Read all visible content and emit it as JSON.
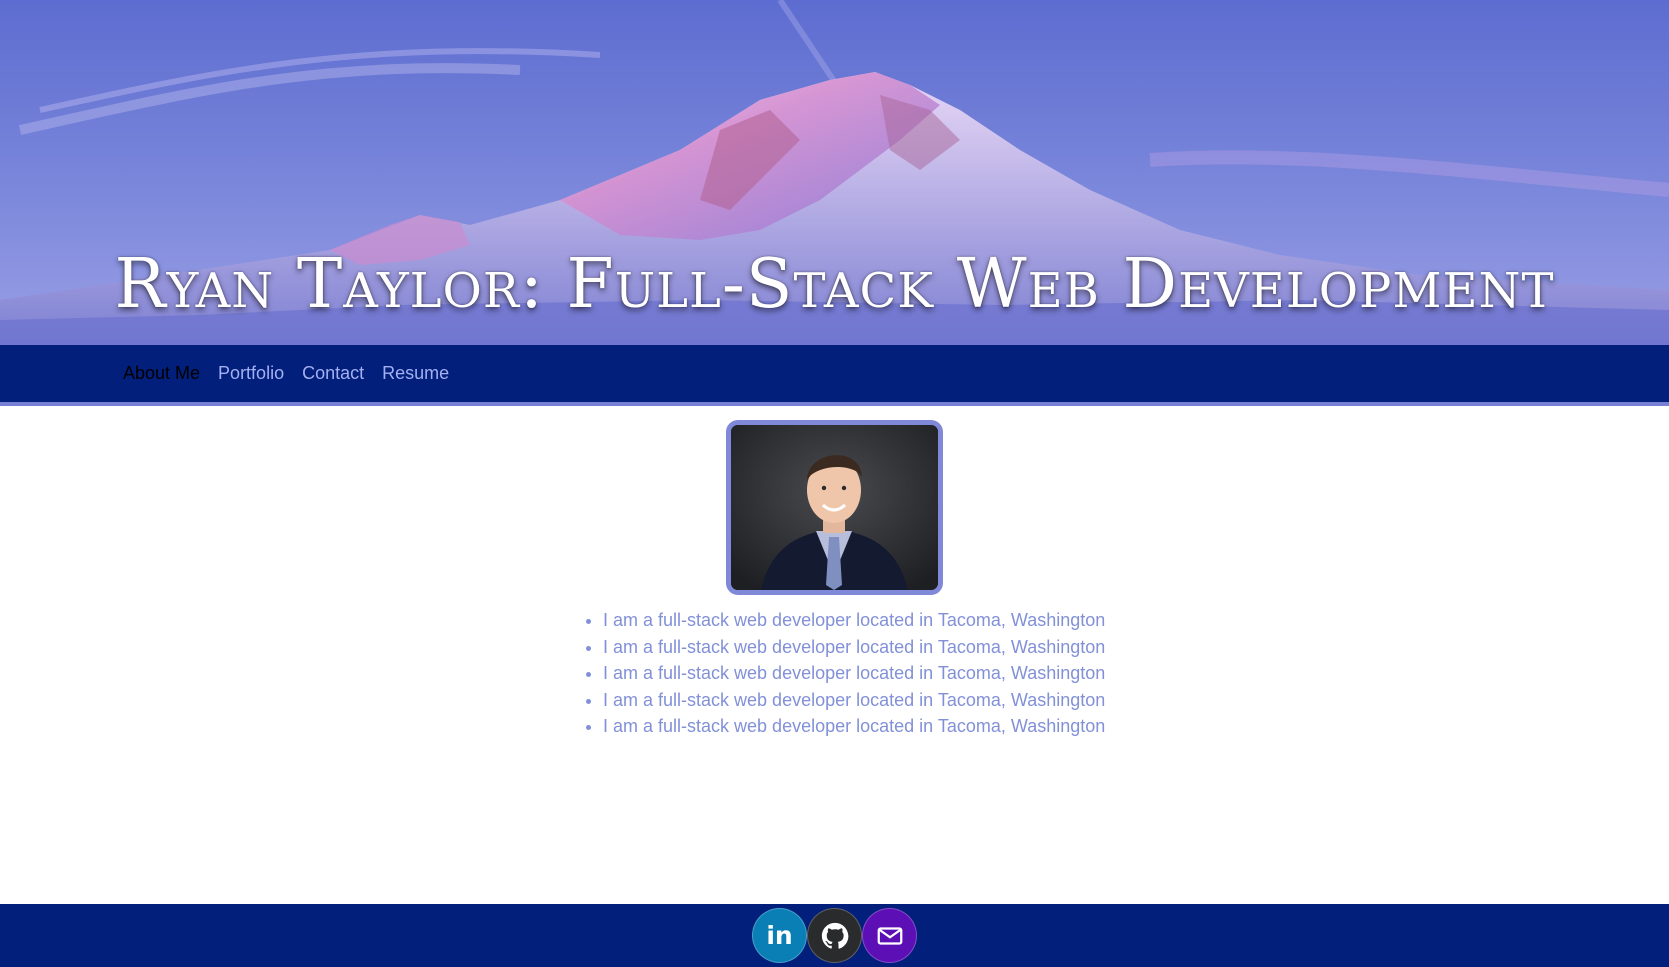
{
  "header": {
    "title": "Ryan Taylor: Full-Stack Web Development"
  },
  "nav": {
    "items": [
      {
        "label": "About Me",
        "active": true
      },
      {
        "label": "Portfolio",
        "active": false
      },
      {
        "label": "Contact",
        "active": false
      },
      {
        "label": "Resume",
        "active": false
      }
    ]
  },
  "about": {
    "bullets": [
      "I am a full-stack web developer located in Tacoma, Washington",
      "I am a full-stack web developer located in Tacoma, Washington",
      "I am a full-stack web developer located in Tacoma, Washington",
      "I am a full-stack web developer located in Tacoma, Washington",
      "I am a full-stack web developer located in Tacoma, Washington"
    ]
  },
  "footer": {
    "socials": [
      {
        "name": "linkedin",
        "icon": "linkedin-icon",
        "text": "in",
        "color": "#0a7fb5"
      },
      {
        "name": "github",
        "icon": "github-icon",
        "color": "#2a2b2d"
      },
      {
        "name": "email",
        "icon": "envelope-icon",
        "color": "#5c0fb5"
      }
    ]
  },
  "colors": {
    "nav_background": "#021f7c",
    "nav_link": "#a4b0f0",
    "accent": "#8088d8",
    "bio_text": "#8290d8"
  }
}
